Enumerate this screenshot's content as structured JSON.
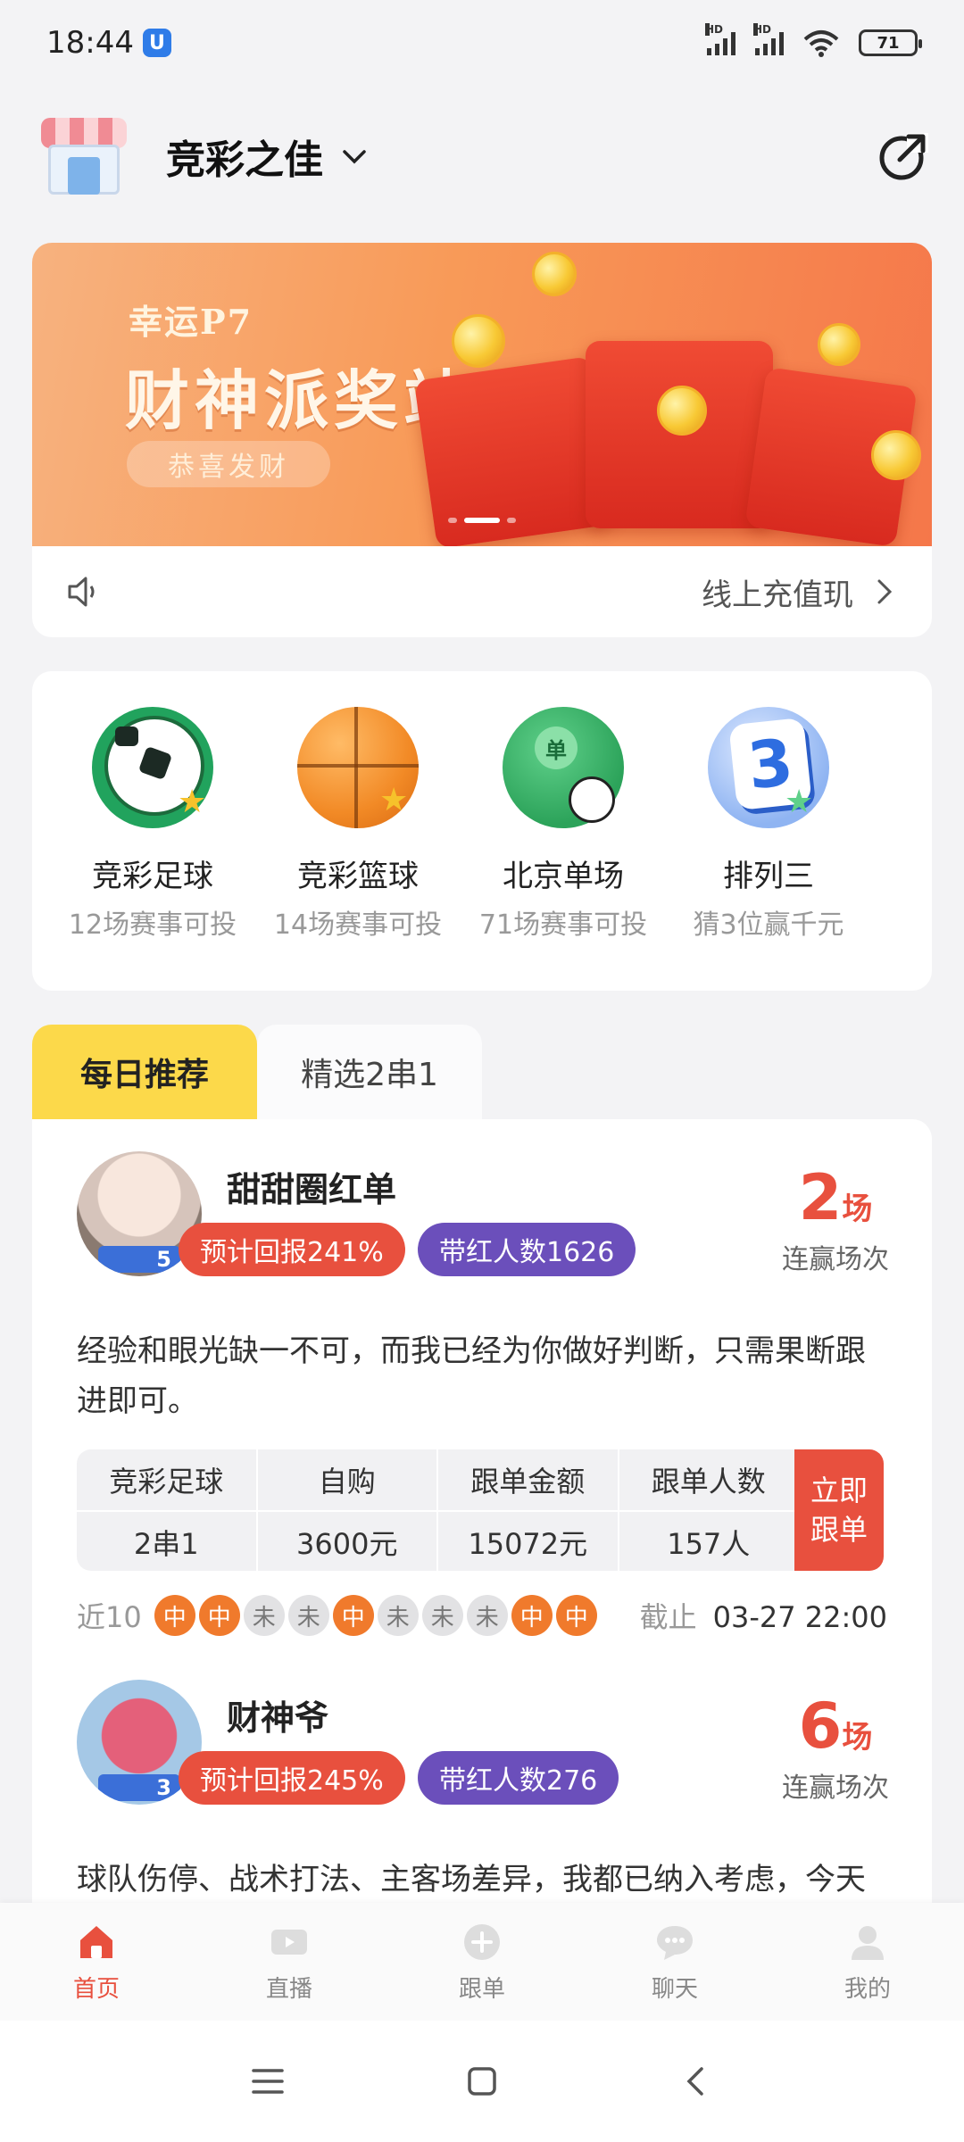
{
  "status_bar": {
    "time": "18:44",
    "shield": "U",
    "signal1_label": "HD",
    "signal2_label": "HD",
    "battery": "71"
  },
  "header": {
    "title": "竞彩之佳",
    "logo_icon": "store-icon",
    "share_icon": "share-icon"
  },
  "banner": {
    "subtitle": "幸运P7",
    "title": "财神派奖站",
    "pill": "恭喜发财",
    "active_slide": 1
  },
  "notice": {
    "text": "线上充值玑"
  },
  "games": [
    {
      "name": "竞彩足球",
      "sub": "12场赛事可投",
      "icon": "football-icon"
    },
    {
      "name": "竞彩篮球",
      "sub": "14场赛事可投",
      "icon": "basketball-icon"
    },
    {
      "name": "北京单场",
      "sub": "71场赛事可投",
      "icon": "beijing-single-icon",
      "tag": "单"
    },
    {
      "name": "排列三",
      "sub": "猜3位赢千元",
      "icon": "pick3-icon",
      "tag": "3"
    }
  ],
  "tabs": {
    "active": "每日推荐",
    "other": "精选2串1"
  },
  "recommendations": [
    {
      "name": "甜甜圈红单",
      "level": "5",
      "return_badge": "预计回报241%",
      "followers_badge": "带红人数1626",
      "streak_num": "2",
      "streak_unit": "场",
      "streak_label": "连赢场次",
      "desc": "经验和眼光缺一不可，而我已经为你做好判断，只需果断跟进即可。",
      "table_head": [
        "竞彩足球",
        "自购",
        "跟单金额",
        "跟单人数"
      ],
      "table_vals": [
        "2串1",
        "3600元",
        "15072元",
        "157人"
      ],
      "follow_btn": "立即跟单",
      "near_label": "近10",
      "history": [
        "中",
        "中",
        "未",
        "未",
        "中",
        "未",
        "未",
        "未",
        "中",
        "中"
      ],
      "deadline_label": "截止",
      "deadline": "03-27 22:00"
    },
    {
      "name": "财神爷",
      "level": "3",
      "return_badge": "预计回报245%",
      "followers_badge": "带红人数276",
      "streak_num": "6",
      "streak_unit": "场",
      "streak_label": "连赢场次",
      "desc": "球队伤停、战术打法、主客场差异，我都已纳入考虑，今天的选择不会让你失望"
    }
  ],
  "bottom_nav": [
    {
      "label": "首页",
      "icon": "home-icon"
    },
    {
      "label": "直播",
      "icon": "live-icon"
    },
    {
      "label": "跟单",
      "icon": "follow-icon"
    },
    {
      "label": "聊天",
      "icon": "chat-icon"
    },
    {
      "label": "我的",
      "icon": "profile-icon"
    }
  ],
  "colors": {
    "accent": "#e8503e",
    "purple": "#6b4fbb",
    "tab_yellow": "#fcd94a",
    "win_dot": "#f07a2c"
  }
}
